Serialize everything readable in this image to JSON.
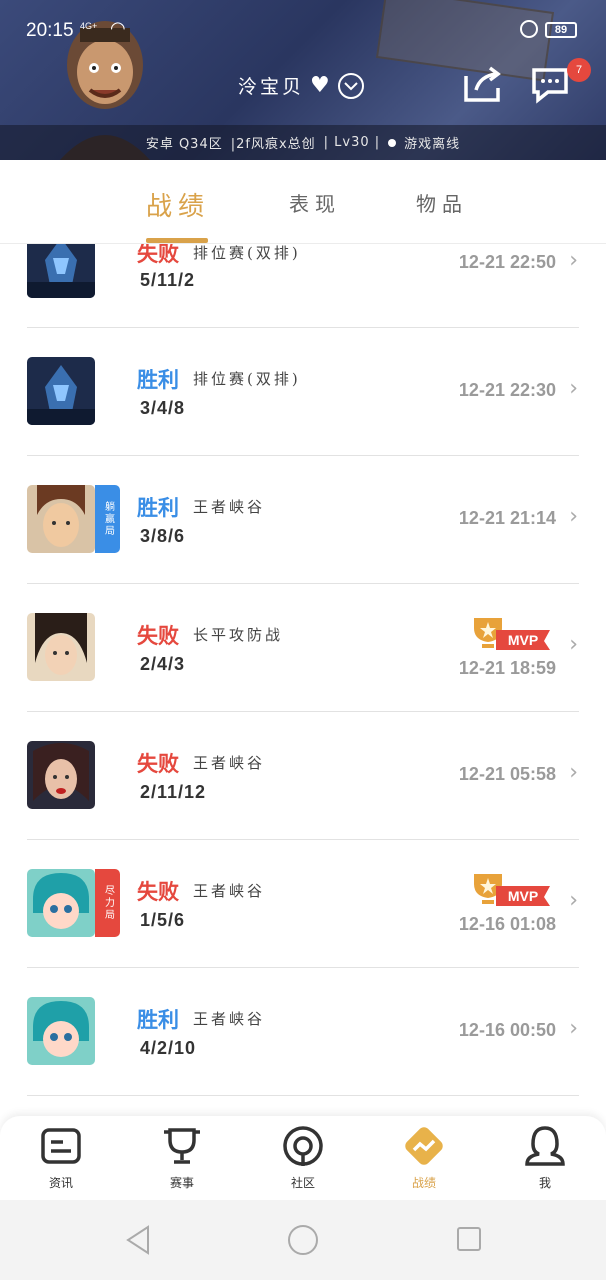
{
  "status_bar": {
    "time": "20:15",
    "signal": "4G+",
    "battery": "89"
  },
  "header": {
    "username": "泠宝贝",
    "heart": "♥",
    "chevron": "⌄",
    "message_count": "7",
    "info": {
      "server": "安卓 Q34区",
      "guild": "|2f风痕x总创",
      "level": "| Lv30 |",
      "status": "游戏离线"
    }
  },
  "tabs": {
    "record": "战绩",
    "performance": "表现",
    "items": "物品"
  },
  "matches": [
    {
      "result": "失败",
      "type": "lose",
      "mode": "排位赛(双排)",
      "kda": "5/11/2",
      "date": "12-21 22:50",
      "avatar": "hero-dark-armor",
      "tag": null,
      "mvp": false
    },
    {
      "result": "胜利",
      "type": "win",
      "mode": "排位赛(双排)",
      "kda": "3/4/8",
      "date": "12-21 22:30",
      "avatar": "hero-dark-armor",
      "tag": null,
      "mvp": false
    },
    {
      "result": "胜利",
      "type": "win",
      "mode": "王者峡谷",
      "kda": "3/8/6",
      "date": "12-21 21:14",
      "avatar": "hero-brown-hair",
      "tag": "躺赢局",
      "tag_color": "#3a8ee6",
      "mvp": false
    },
    {
      "result": "失败",
      "type": "lose",
      "mode": "长平攻防战",
      "kda": "2/4/3",
      "date": "12-21 18:59",
      "avatar": "hero-dark-hair",
      "tag": null,
      "mvp": true
    },
    {
      "result": "失败",
      "type": "lose",
      "mode": "王者峡谷",
      "kda": "2/11/12",
      "date": "12-21 05:58",
      "avatar": "hero-red-lips",
      "tag": null,
      "mvp": false
    },
    {
      "result": "失败",
      "type": "lose",
      "mode": "王者峡谷",
      "kda": "1/5/6",
      "date": "12-16 01:08",
      "avatar": "hero-teal-child",
      "tag": "尽力局",
      "tag_color": "#e5483e",
      "mvp": true
    },
    {
      "result": "胜利",
      "type": "win",
      "mode": "王者峡谷",
      "kda": "4/2/10",
      "date": "12-16 00:50",
      "avatar": "hero-teal-child",
      "tag": null,
      "mvp": false
    }
  ],
  "mvp_label": "MVP",
  "bottom_nav": [
    {
      "label": "资讯",
      "icon": "news-icon"
    },
    {
      "label": "赛事",
      "icon": "trophy-icon"
    },
    {
      "label": "社区",
      "icon": "community-icon"
    },
    {
      "label": "战绩",
      "icon": "record-icon",
      "active": true
    },
    {
      "label": "我",
      "icon": "profile-icon"
    }
  ],
  "colors": {
    "accent": "#d9a24a",
    "win": "#3a8ee6",
    "lose": "#e5483e"
  }
}
